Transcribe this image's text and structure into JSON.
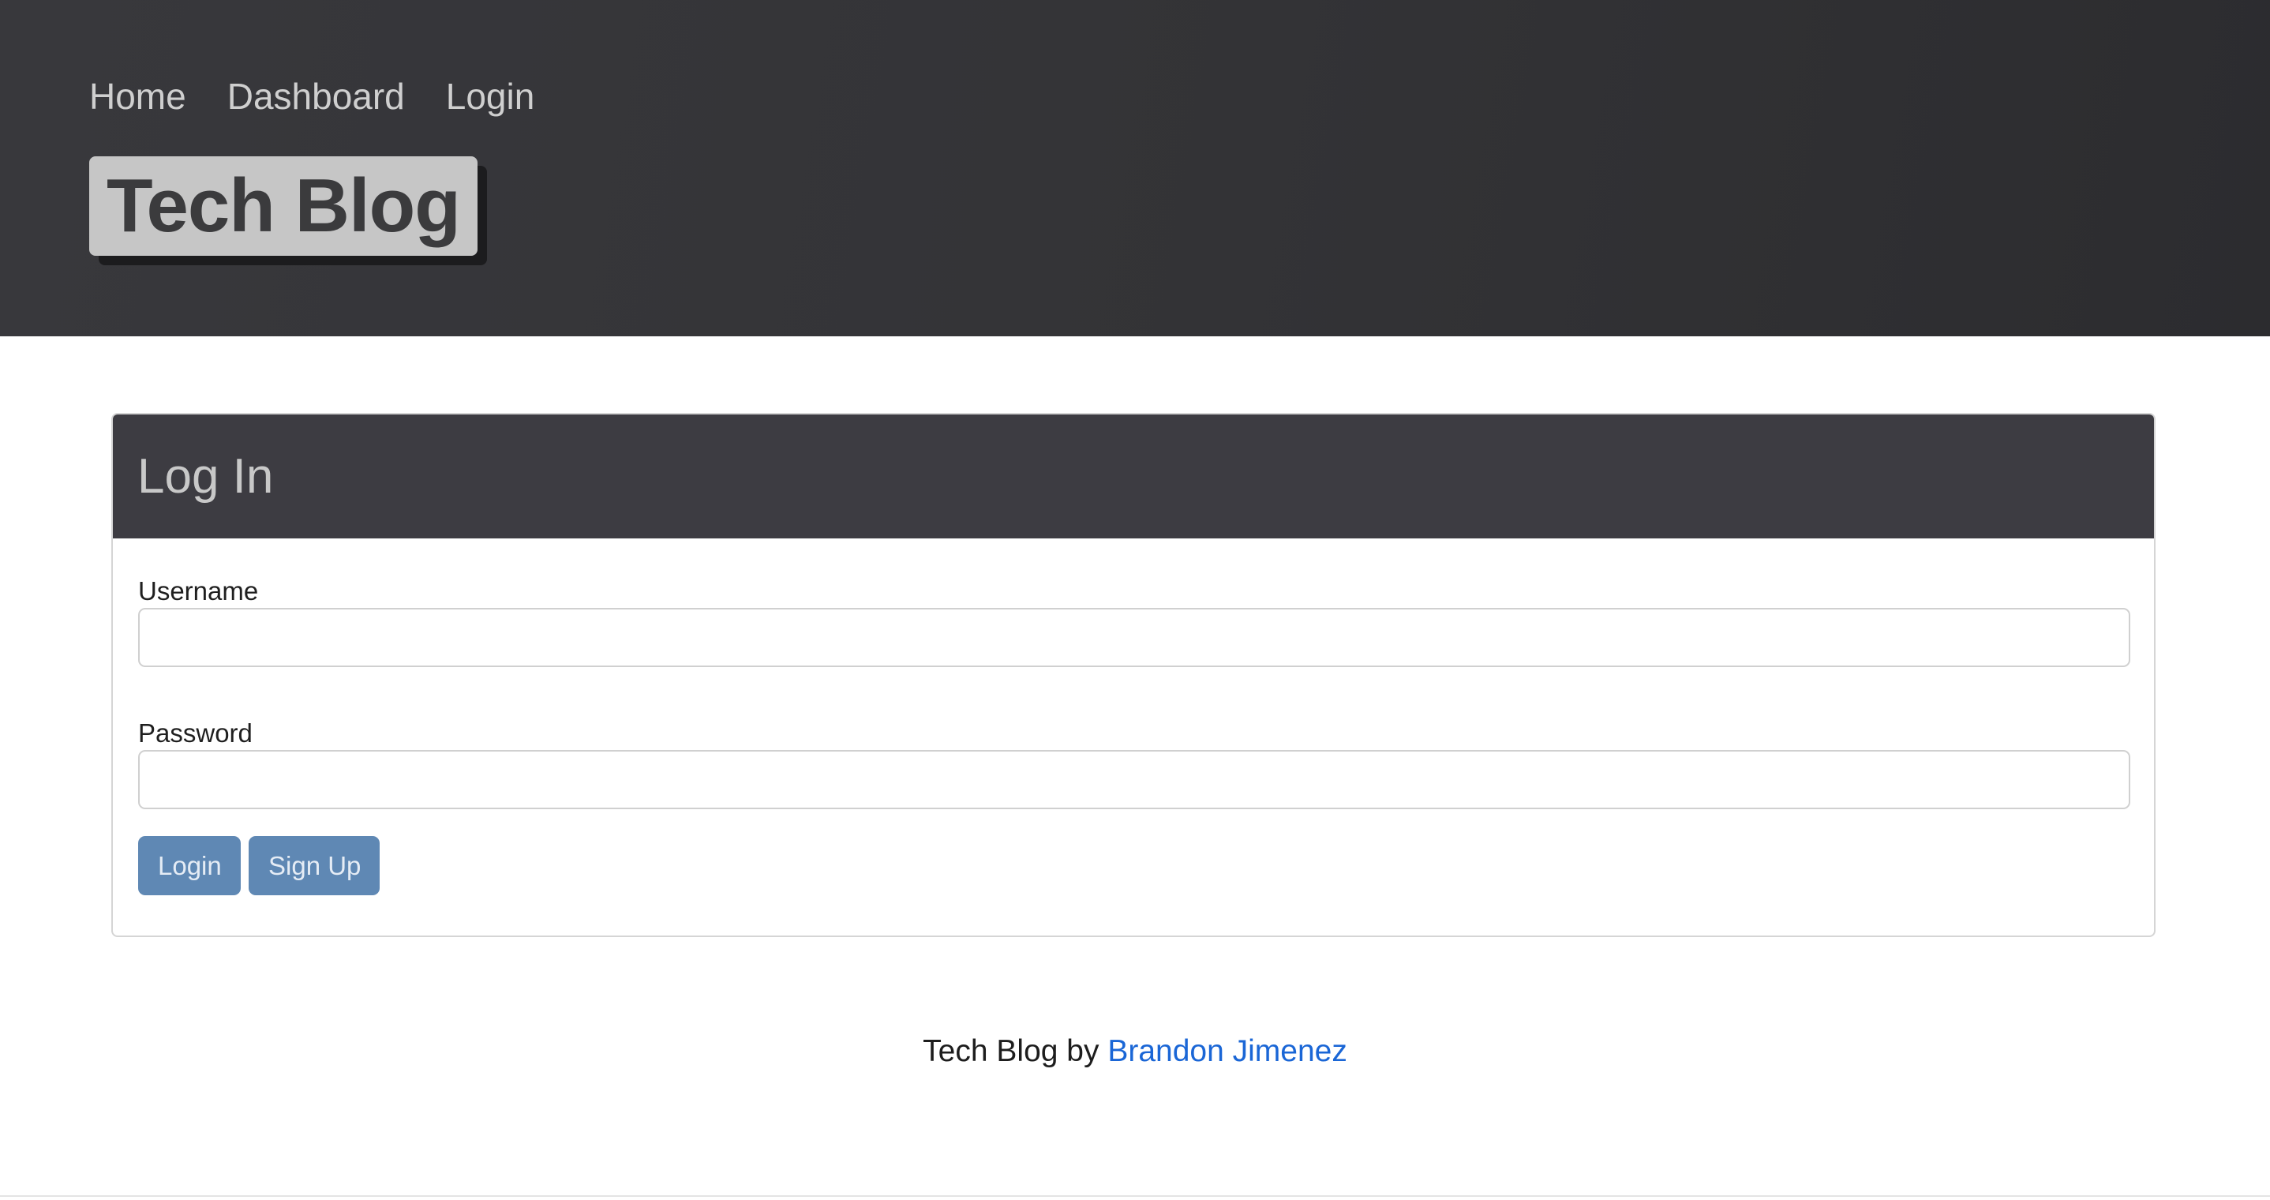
{
  "nav": {
    "items": [
      {
        "label": "Home"
      },
      {
        "label": "Dashboard"
      },
      {
        "label": "Login"
      }
    ]
  },
  "brand": {
    "title": "Tech Blog"
  },
  "login_card": {
    "title": "Log In",
    "username_label": "Username",
    "username_value": "",
    "password_label": "Password",
    "password_value": "",
    "login_button": "Login",
    "signup_button": "Sign Up"
  },
  "footer": {
    "prefix": "Tech Blog by ",
    "author": "Brandon Jimenez"
  },
  "colors": {
    "header_bg": "#333336",
    "card_header_bg": "#3d3c42",
    "button_bg": "#5f88b4",
    "link": "#1a66d6"
  }
}
